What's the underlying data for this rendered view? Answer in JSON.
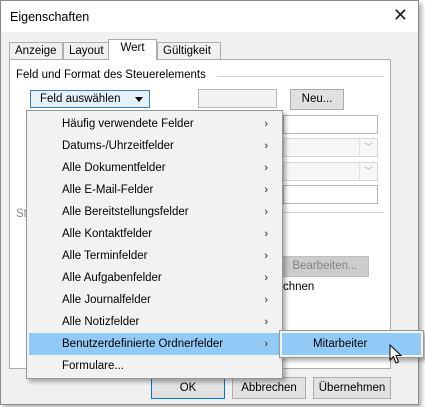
{
  "window": {
    "title": "Eigenschaften"
  },
  "tabs": [
    {
      "label": "Anzeige"
    },
    {
      "label": "Layout"
    },
    {
      "label": "Wert",
      "active": true
    },
    {
      "label": "Gültigkeit"
    }
  ],
  "group": {
    "label": "Feld und Format des Steuerelements"
  },
  "field_button": {
    "label": "Feld auswählen"
  },
  "new_button": {
    "label": "Neu..."
  },
  "edit_button": {
    "label": "Bearbeiten...",
    "disabled": true
  },
  "partial_text": {
    "left": "St",
    "right": "chnen"
  },
  "bottom_buttons": {
    "ok": "OK",
    "cancel": "Abbrechen",
    "apply": "Übernehmen"
  },
  "menu": {
    "items": [
      {
        "label": "Häufig verwendete Felder",
        "submenu": true
      },
      {
        "label": "Datums-/Uhrzeitfelder",
        "submenu": true
      },
      {
        "label": "Alle Dokumentfelder",
        "submenu": true
      },
      {
        "label": "Alle E-Mail-Felder",
        "submenu": true
      },
      {
        "label": "Alle Bereitstellungsfelder",
        "submenu": true
      },
      {
        "label": "Alle Kontaktfelder",
        "submenu": true
      },
      {
        "label": "Alle Terminfelder",
        "submenu": true
      },
      {
        "label": "Alle Aufgabenfelder",
        "submenu": true
      },
      {
        "label": "Alle Journalfelder",
        "submenu": true
      },
      {
        "label": "Alle Notizfelder",
        "submenu": true
      },
      {
        "label": "Benutzerdefinierte Ordnerfelder",
        "submenu": true,
        "highlighted": true
      },
      {
        "label": "Formulare...",
        "submenu": false
      }
    ],
    "arrow_glyph": "›"
  },
  "submenu": {
    "items": [
      {
        "label": "Mitarbeiter",
        "highlighted": true
      }
    ]
  },
  "icons": {
    "close": "close-icon",
    "dropdown": "chevron-down-icon",
    "submenu": "chevron-right-icon",
    "cursor": "mouse-pointer-icon"
  },
  "colors": {
    "highlight": "#91c9f7",
    "dialog_bg": "#f0f0f0",
    "accent_border": "#0078d7"
  }
}
